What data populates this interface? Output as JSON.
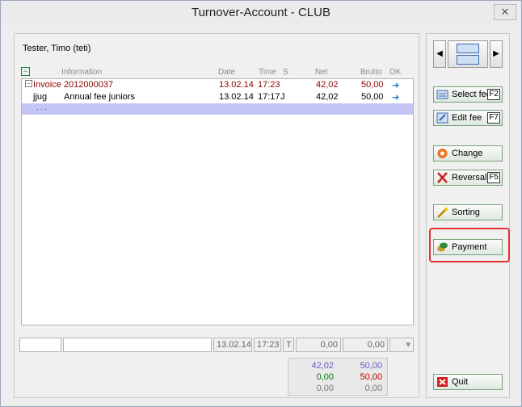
{
  "window": {
    "title": "Turnover-Account - CLUB",
    "close_label": "✕"
  },
  "customer": {
    "name": "Tester, Timo (teti)"
  },
  "columns": {
    "information": "Information",
    "date": "Date",
    "time": "Time",
    "s": "S",
    "net": "Net",
    "brutto": "Brutto",
    "ok": "OK"
  },
  "rows": [
    {
      "info": "Invoice 2012000037",
      "code": "",
      "date": "13.02.14",
      "time": "17:23",
      "s": "",
      "net": "42,02",
      "brutto": "50,00"
    },
    {
      "info": "Annual fee juniors",
      "code": "jjug",
      "date": "13.02.14",
      "time": "17:17",
      "s": "J",
      "net": "42,02",
      "brutto": "50,00"
    },
    {
      "info": ". . .",
      "code": "",
      "date": "",
      "time": "",
      "s": "",
      "net": "",
      "brutto": ""
    }
  ],
  "entry": {
    "date": "13.02.14",
    "time": "17:23",
    "type": "T",
    "net": "0,00",
    "brutto": "0,00"
  },
  "totals": {
    "r1_net": "42,02",
    "r1_brutto": "50,00",
    "r2_net": "0,00",
    "r2_brutto": "50,00",
    "r3_net": "0,00",
    "r3_brutto": "0,00"
  },
  "buttons": {
    "select_fee": "Select fee",
    "select_fee_key": "F2",
    "edit_fee": "Edit fee",
    "edit_fee_key": "F7",
    "change": "Change",
    "reversal": "Reversal",
    "reversal_key": "F5",
    "sorting": "Sorting",
    "payment": "Payment",
    "quit": "Quit"
  },
  "colors": {
    "invoice_red": "#8b0000",
    "totals_blue": "#6a5acd",
    "totals_green": "#008000",
    "totals_red": "#c00000",
    "highlight": "#e23030"
  }
}
